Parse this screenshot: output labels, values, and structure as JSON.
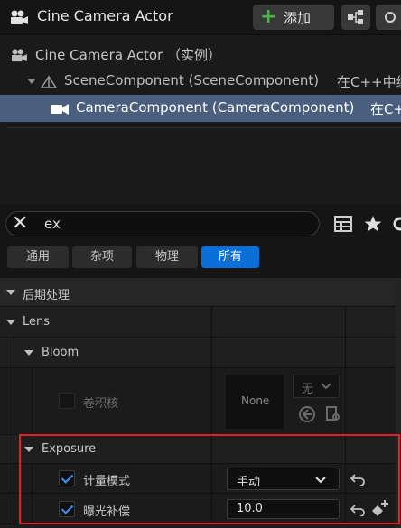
{
  "header": {
    "title": "Cine Camera Actor",
    "add_label": "添加",
    "icons": [
      "camera-actor-icon",
      "add-plus-icon",
      "blueprint-icon"
    ]
  },
  "tree": {
    "rows": [
      {
        "label": "Cine Camera Actor （实例）"
      },
      {
        "label": "SceneComponent (SceneComponent)",
        "suffix": "在C++中编"
      },
      {
        "label": "CameraComponent (CameraComponent)",
        "suffix": "在C++"
      }
    ]
  },
  "search": {
    "value": "ex"
  },
  "tabs": [
    {
      "label": "通用"
    },
    {
      "label": "杂项"
    },
    {
      "label": "物理"
    },
    {
      "label": "所有"
    }
  ],
  "active_tab": "所有",
  "details": {
    "postprocess_label": "后期处理",
    "lens_label": "Lens",
    "bloom_label": "Bloom",
    "convolution_label": "卷积核",
    "convolution_value": "None",
    "convolution_dropdown": "无",
    "exposure_label": "Exposure",
    "metering_label": "计量模式",
    "metering_value": "手动",
    "metering_checked": true,
    "comp_label": "曝光补偿",
    "comp_value": "10.0",
    "comp_checked": true
  },
  "colors": {
    "accent": "#0a6fd8",
    "selection": "#4a5f7e",
    "highlight_box": "#e0202a",
    "add_plus": "#4bb34b",
    "checkmark": "#3d8fff"
  }
}
